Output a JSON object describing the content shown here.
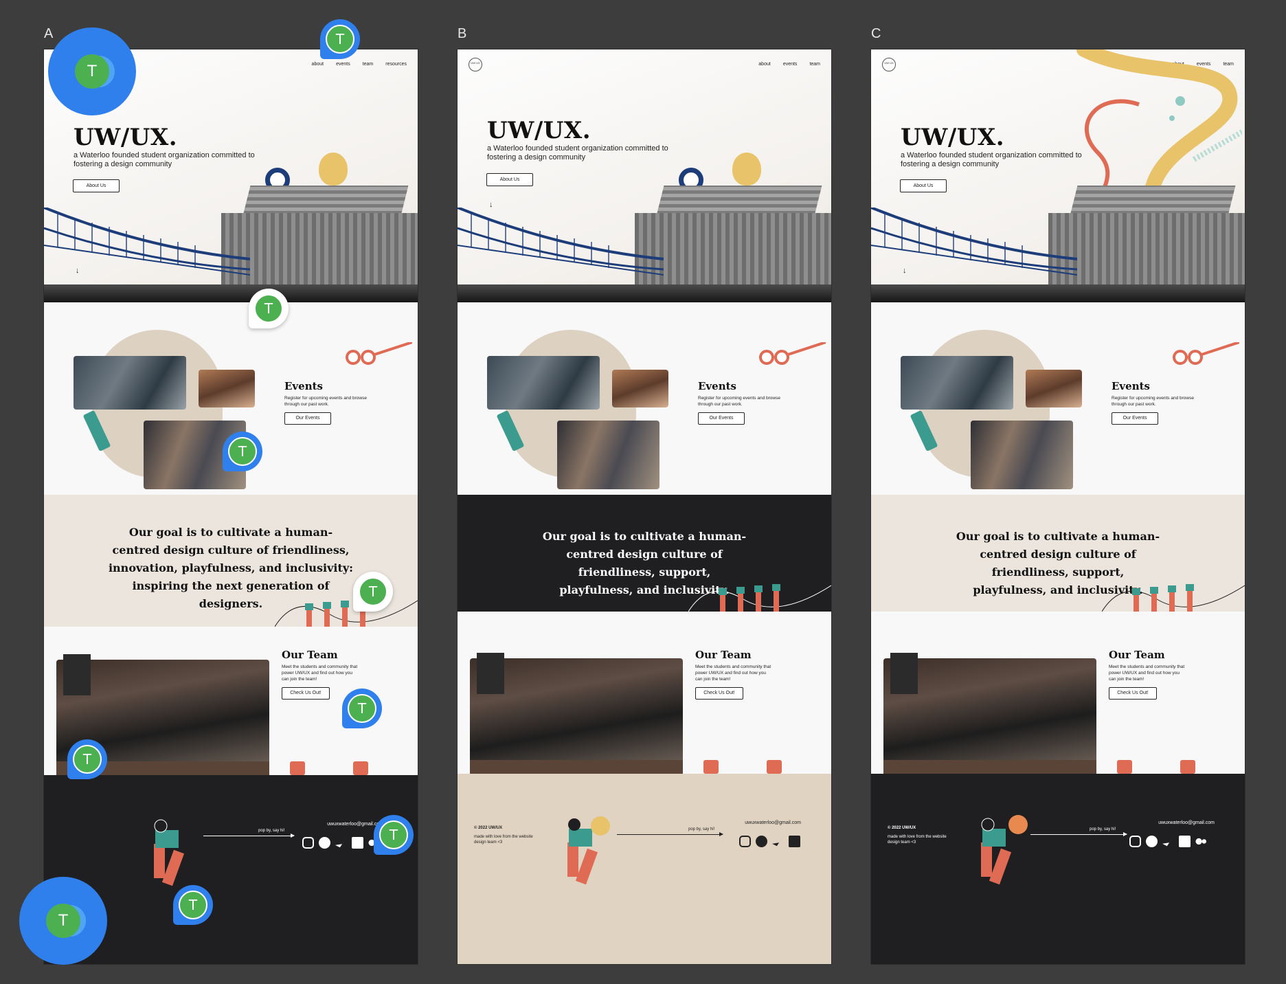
{
  "labels": {
    "a": "A",
    "b": "B",
    "c": "C"
  },
  "logo_text": "UW UX",
  "nav": {
    "about": "about",
    "events": "events",
    "team": "team",
    "resources": "resources"
  },
  "hero": {
    "title": "UW/UX.",
    "subtitle": "a Waterloo founded student organization committed to fostering a design community",
    "about_button": "About Us",
    "scroll_arrow": "↓"
  },
  "events": {
    "title": "Events",
    "description": "Register for upcoming events and browse through our past work.",
    "button": "Our Events"
  },
  "goal": {
    "text_a": "Our goal is to cultivate a human-centred design culture of friendliness, innovation, playfulness, and inclusivity: inspiring the next generation of designers.",
    "text_bc": "Our goal is to cultivate a human-centred design culture of friendliness, support, playfulness, and inclusivity."
  },
  "team": {
    "title": "Our Team",
    "description": "Meet the students and community that power UW/UX and find out how you can join the team!",
    "button": "Check Us Out!"
  },
  "footer": {
    "copyright": "© 2022 UW/UX",
    "made_with": "made with love from the website design team <3",
    "email": "uwuxwaterloo@gmail.com",
    "pop_by": "pop by, say hi!"
  },
  "social_icons": [
    "instagram-icon",
    "facebook-icon",
    "twitter-icon",
    "linkedin-icon",
    "medium-icon"
  ],
  "comment_avatar_initial": "T",
  "colors": {
    "canvas": "#3d3d3d",
    "accent_blue": "#2f80ed",
    "avatar_green": "#4caf50",
    "beige": "#ece5dd",
    "dark": "#1f1f22",
    "sand_footer": "#e1d3c1",
    "coral": "#e06b55",
    "gold": "#e8c36a"
  }
}
